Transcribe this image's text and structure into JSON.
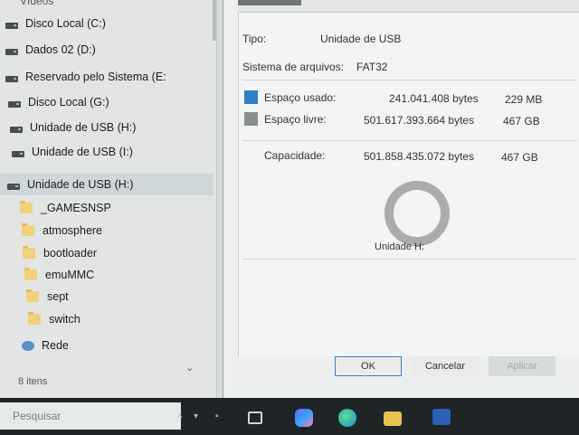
{
  "nav": {
    "top_clipped": "Vídeos",
    "items": [
      {
        "label": "Disco Local (C:)",
        "icon": "drive-icon"
      },
      {
        "label": "Dados 02 (D:)",
        "icon": "drive-icon"
      },
      {
        "label": "Reservado pelo Sistema (E:",
        "icon": "drive-icon"
      },
      {
        "label": "Disco Local (G:)",
        "icon": "drive-icon"
      },
      {
        "label": "Unidade de USB (H:)",
        "icon": "drive-icon"
      },
      {
        "label": "Unidade de USB (I:)",
        "icon": "drive-icon"
      },
      {
        "label": "Unidade de USB (H:)",
        "icon": "drive-icon",
        "selected": true
      },
      {
        "label": "_GAMESNSP",
        "icon": "folder-icon"
      },
      {
        "label": "atmosphere",
        "icon": "folder-icon"
      },
      {
        "label": "bootloader",
        "icon": "folder-icon"
      },
      {
        "label": "emuMMC",
        "icon": "folder-icon"
      },
      {
        "label": "sept",
        "icon": "folder-icon"
      },
      {
        "label": "switch",
        "icon": "folder-icon"
      },
      {
        "label": "Rede",
        "icon": "network-icon"
      }
    ],
    "status_count": "8 itens"
  },
  "dialog": {
    "tipo_label": "Tipo:",
    "tipo_value": "Unidade de USB",
    "fs_label": "Sistema de arquivos:",
    "fs_value": "FAT32",
    "used_label": "Espaço usado:",
    "used_bytes": "241.041.408 bytes",
    "used_short": "229 MB",
    "free_label": "Espaço livre:",
    "free_bytes": "501.617.393.664 bytes",
    "free_short": "467 GB",
    "cap_label": "Capacidade:",
    "cap_bytes": "501.858.435.072 bytes",
    "cap_short": "467 GB",
    "drive_caption": "Unidade H:",
    "ok_label": "OK",
    "cancel_label": "Cancelar",
    "apply_label": "Aplicar",
    "colors": {
      "used": "#2f7fc4",
      "free": "#8b8e90"
    }
  },
  "taskbar": {
    "search_placeholder": "Pesquisar",
    "icons": [
      "task-view-icon",
      "copilot-icon",
      "edge-icon",
      "file-explorer-icon",
      "store-icon",
      "word-icon"
    ]
  }
}
